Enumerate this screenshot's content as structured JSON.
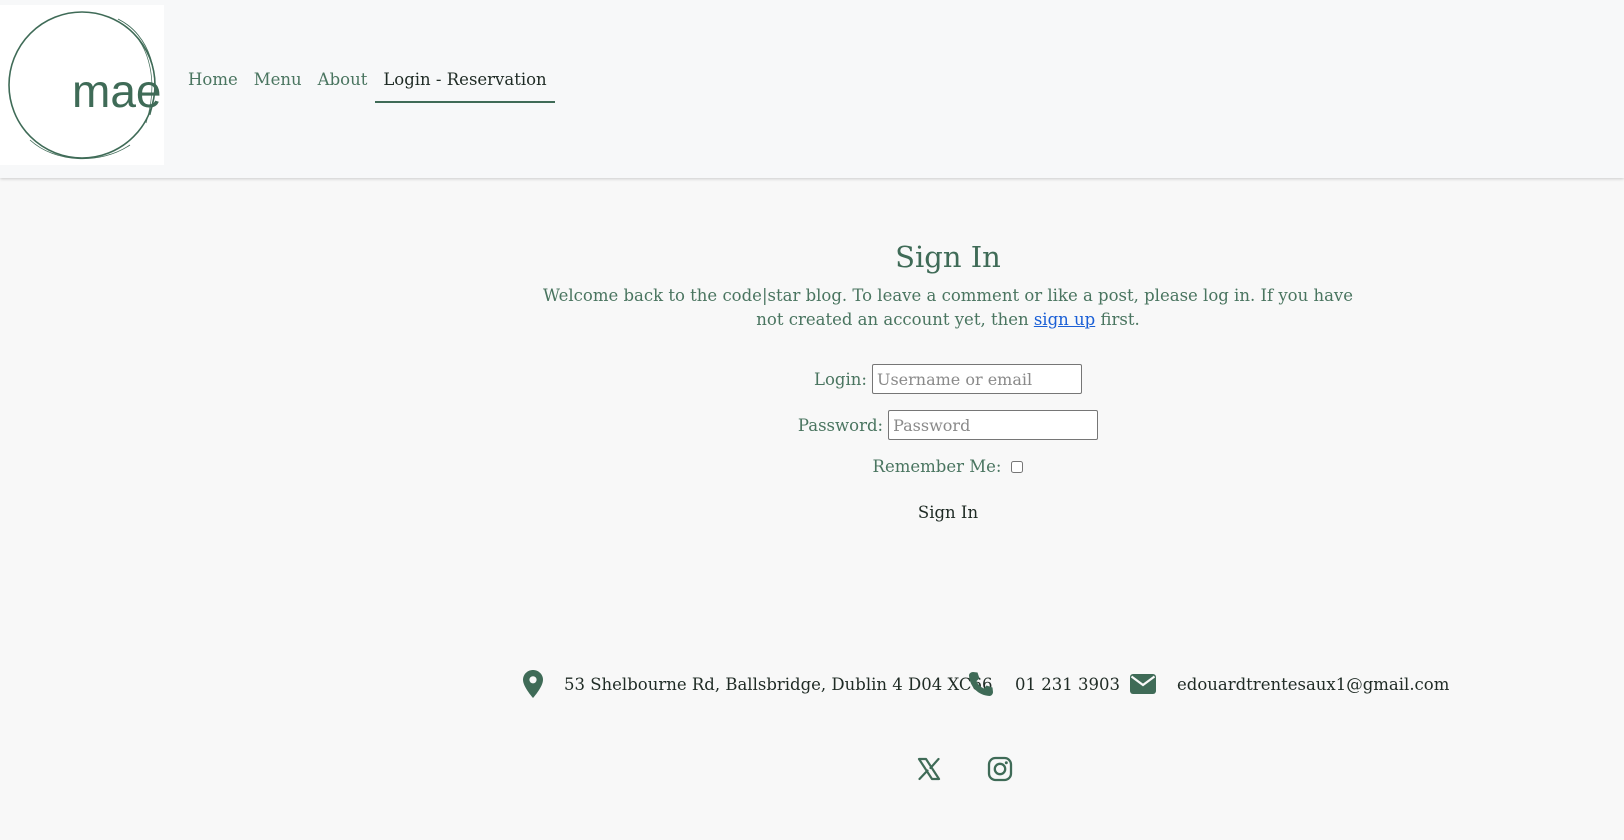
{
  "header": {
    "logo_text": "mae",
    "nav": [
      {
        "label": "Home",
        "active": false
      },
      {
        "label": "Menu",
        "active": false
      },
      {
        "label": "About",
        "active": false
      },
      {
        "label": "Login - Reservation",
        "active": true
      }
    ]
  },
  "signin": {
    "title": "Sign In",
    "intro_before": "Welcome back to the code|star blog. To leave a comment or like a post, please log in. If you have not created an account yet, then ",
    "intro_link": "sign up",
    "intro_after": " first.",
    "login_label": "Login:",
    "login_placeholder": "Username or email",
    "login_value": "",
    "password_label": "Password:",
    "password_placeholder": "Password",
    "password_value": "",
    "remember_label": "Remember Me:",
    "remember_checked": false,
    "submit_label": "Sign In"
  },
  "footer": {
    "address": "53 Shelbourne Rd, Ballsbridge, Dublin 4 D04 XC66",
    "phone": "01 231 3903",
    "email": "edouardtrentesaux1@gmail.com",
    "address_icon": "map-pin-icon",
    "phone_icon": "phone-icon",
    "email_icon": "envelope-icon",
    "social_icons": [
      "x-twitter-icon",
      "instagram-icon"
    ]
  },
  "colors": {
    "brand_green": "#3f6b57",
    "text_green": "#4a7560",
    "link_blue": "#1a5fd6",
    "page_bg": "#f8f8f8"
  }
}
